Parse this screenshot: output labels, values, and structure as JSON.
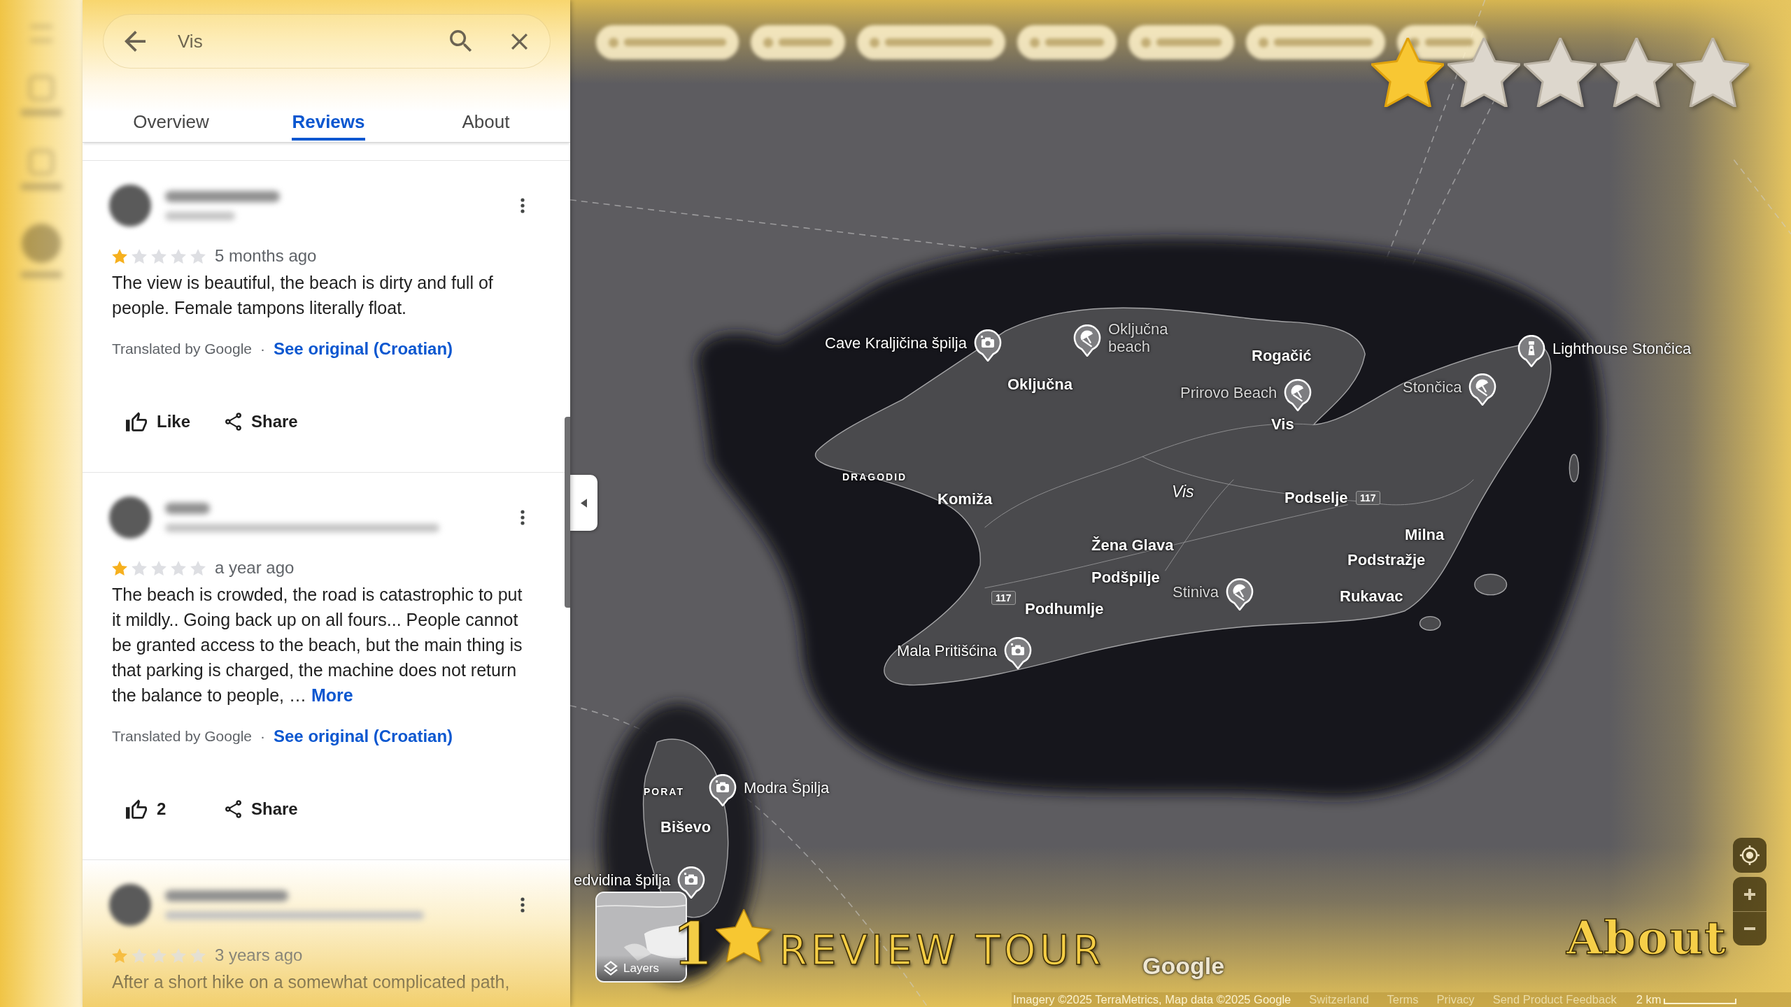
{
  "search": {
    "value": "Vis"
  },
  "tabs": [
    {
      "label": "Overview",
      "selected": false
    },
    {
      "label": "Reviews",
      "selected": true
    },
    {
      "label": "About",
      "selected": false
    }
  ],
  "reviews": [
    {
      "stars": 1,
      "time": "5 months ago",
      "text": "The view is beautiful, the beach is dirty and full of people. Female tampons literally float.",
      "translation_note": "Translated by Google",
      "separator": "·",
      "original_link": "See original (Croatian)",
      "like_label": "Like",
      "share_label": "Share"
    },
    {
      "stars": 1,
      "time": "a year ago",
      "text": "The beach is crowded, the road is catastrophic to put it mildly.. Going back up on all fours... People cannot be granted access to the beach, but the main thing is that parking is charged, the machine does not return the balance to people, …",
      "more_link": "More",
      "translation_note": "Translated by Google",
      "separator": "·",
      "original_link": "See original (Croatian)",
      "like_label": "2",
      "share_label": "Share"
    },
    {
      "stars": 1,
      "time": "3 years ago",
      "text": "After a short hike on a somewhat complicated path,"
    }
  ],
  "map": {
    "rating_overlay": {
      "stars": 1
    },
    "places": [
      {
        "name": "Cave Kraljičina špilja",
        "kind": "sight"
      },
      {
        "name": "Oključna beach",
        "kind": "beach"
      },
      {
        "name": "Rogačić",
        "kind": "town"
      },
      {
        "name": "Lighthouse Stončica",
        "kind": "lighthouse"
      },
      {
        "name": "Oključna",
        "kind": "town"
      },
      {
        "name": "Prirovo Beach",
        "kind": "beach"
      },
      {
        "name": "Stončica",
        "kind": "beach"
      },
      {
        "name": "Vis",
        "kind": "town"
      },
      {
        "name": "DRAGODID",
        "kind": "locality"
      },
      {
        "name": "Komiža",
        "kind": "town"
      },
      {
        "name": "Vis",
        "kind": "island"
      },
      {
        "name": "Podselje",
        "kind": "town"
      },
      {
        "name": "117",
        "kind": "road"
      },
      {
        "name": "Žena Glava",
        "kind": "town"
      },
      {
        "name": "Milna",
        "kind": "town"
      },
      {
        "name": "Podstražje",
        "kind": "town"
      },
      {
        "name": "Podšpilje",
        "kind": "town"
      },
      {
        "name": "117",
        "kind": "road"
      },
      {
        "name": "Podhumlje",
        "kind": "town"
      },
      {
        "name": "Stiniva",
        "kind": "beach"
      },
      {
        "name": "Rukavac",
        "kind": "town"
      },
      {
        "name": "Mala Pritišćina",
        "kind": "sight"
      },
      {
        "name": "PORAT",
        "kind": "locality"
      },
      {
        "name": "Modra Špilja",
        "kind": "sight"
      },
      {
        "name": "Biševo",
        "kind": "town"
      },
      {
        "name": "edvidina špilja",
        "kind": "sight"
      }
    ],
    "layers_button": {
      "label": "Layers"
    },
    "title_overlay": {
      "number": "1",
      "words": "REVIEW TOUR"
    },
    "logo": "Google",
    "corner_label": "About",
    "footer": {
      "attribution": "Imagery ©2025 TerraMetrics, Map data ©2025 Google",
      "links": [
        "Switzerland",
        "Terms",
        "Privacy",
        "Send Product Feedback"
      ],
      "scale": "2 km"
    }
  }
}
